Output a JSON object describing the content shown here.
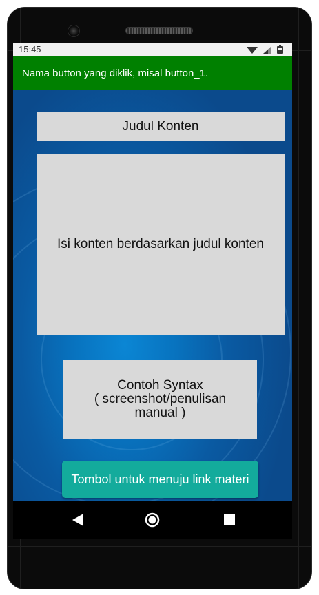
{
  "status_bar": {
    "time": "15:45",
    "icons": [
      "wifi-icon",
      "signal-icon",
      "battery-icon"
    ]
  },
  "app_bar": {
    "title": "Nama button yang diklik, misal button_1.",
    "color": "#008000"
  },
  "content": {
    "title": "Judul Konten",
    "body": "Isi konten berdasarkan judul konten",
    "syntax_lines": [
      "Contoh Syntax",
      "( screenshot/penulisan",
      "manual )"
    ],
    "link_button": "Tombol untuk menuju link materi",
    "link_button_color": "#13ab9c",
    "box_color": "#d9d9d9"
  },
  "nav_bar": {
    "buttons": [
      "back-icon",
      "home-icon",
      "recent-apps-icon"
    ]
  }
}
